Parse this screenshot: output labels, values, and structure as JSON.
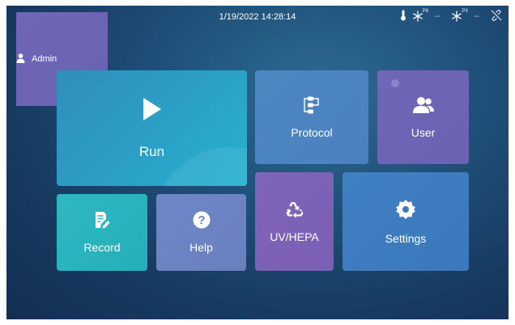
{
  "topbar": {
    "user_label": "Admin",
    "datetime": "1/19/2022 14:28:14",
    "sensor1_tag": "P8",
    "sensor1_value": "--",
    "sensor2_tag": "P3",
    "sensor2_value": "--"
  },
  "tiles": {
    "run": "Run",
    "record": "Record",
    "help": "Help",
    "protocol": "Protocol",
    "user": "User",
    "uvhepa": "UV/HEPA",
    "settings": "Settings"
  },
  "icons": {
    "user": "person-icon",
    "thermometer": "thermometer-icon",
    "snowflake": "snowflake-icon",
    "link": "link-off-icon",
    "run": "play-icon",
    "record": "edit-document-icon",
    "help": "question-icon",
    "protocol": "flow-icon",
    "user_tile": "users-icon",
    "uvhepa": "recycle-icon",
    "settings": "gear-icon"
  },
  "colors": {
    "background": "#1b4670",
    "run": "#2ba0c6",
    "record": "#24b0b8",
    "help": "#6a7fbe",
    "protocol": "#4b80bf",
    "user": "#6a62b3",
    "uvhepa": "#7a5fb4",
    "settings": "#3b78bc"
  }
}
